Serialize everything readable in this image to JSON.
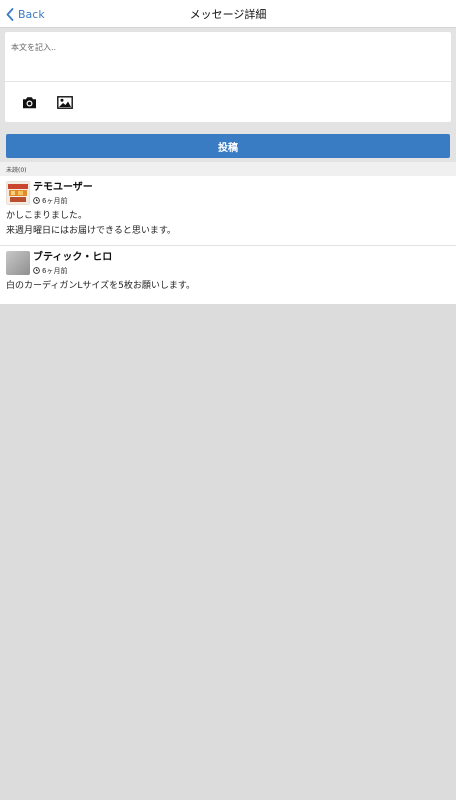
{
  "nav": {
    "back_label": "Back",
    "title": "メッセージ詳細"
  },
  "compose": {
    "placeholder": "本文を記入..",
    "tools": [
      "camera-icon",
      "image-icon"
    ]
  },
  "post_button_label": "投稿",
  "unread_label": "未読(0)",
  "messages": [
    {
      "sender": "テモユーザー",
      "time": "6ヶ月前",
      "lines": [
        "かしこまりました。",
        "来週月曜日にはお届けできると思います。"
      ],
      "avatar": "product-photo-avatar"
    },
    {
      "sender": "ブティック・ヒロ",
      "time": "6ヶ月前",
      "lines": [
        "白のカーディガンLサイズを5枚お願いします。"
      ],
      "avatar": "gray-avatar"
    }
  ],
  "colors": {
    "accent": "#3a7cc4",
    "background": "#dcdcdc"
  }
}
